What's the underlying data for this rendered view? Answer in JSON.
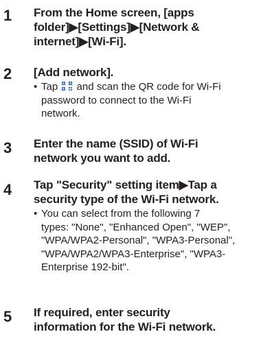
{
  "steps": [
    {
      "number": "1",
      "title_lines": [
        "From the Home screen, [apps",
        "folder]▶[Settings]▶[Network &",
        "internet]▶[Wi-Fi]."
      ]
    },
    {
      "number": "2",
      "title_lines": [
        "[Add network]."
      ],
      "note": {
        "bullet": "•",
        "lines": [
          {
            "before": "Tap ",
            "icon": "qr-scan-icon",
            "after": " and scan the QR code for Wi-Fi"
          },
          {
            "text": "password to connect to the Wi-Fi"
          },
          {
            "text": "network."
          }
        ]
      }
    },
    {
      "number": "3",
      "title_lines": [
        "Enter the name (SSID) of Wi-Fi",
        "network you want to add."
      ]
    },
    {
      "number": "4",
      "title_lines": [
        "Tap \"Security\" setting item▶Tap a",
        "security type of the Wi-Fi network."
      ],
      "note": {
        "bullet": "•",
        "lines": [
          {
            "text": "You can select from the following 7"
          },
          {
            "text": "types: \"None\", \"Enhanced Open\", \"WEP\","
          },
          {
            "text": "\"WPA/WPA2-Personal\", \"WPA3-Personal\","
          },
          {
            "text": "\"WPA/WPA2/WPA3-Enterprise\", \"WPA3-"
          },
          {
            "text": "Enterprise 192-bit\"."
          }
        ]
      }
    },
    {
      "number": "5",
      "title_lines": [
        "If required, enter security",
        "information for the Wi-Fi network."
      ]
    }
  ],
  "colors": {
    "text": "#231f20",
    "icon_blue": "#2a6fd6"
  }
}
